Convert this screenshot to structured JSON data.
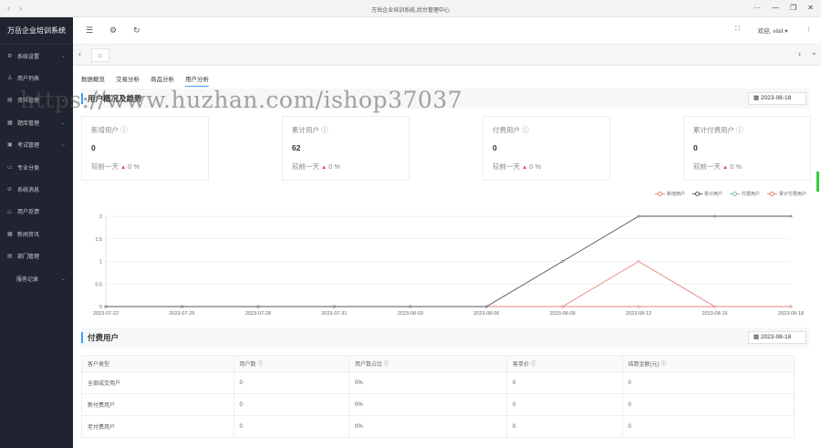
{
  "browser": {
    "url_text": "万岳企业培训系统,后台管理中心",
    "nav_back": "‹",
    "nav_forward": "›",
    "win_more": "···",
    "win_min": "—",
    "win_max": "❐",
    "win_close": "✕"
  },
  "sidebar": {
    "brand": "万岳企业培训系统",
    "items": [
      {
        "icon": "⚙",
        "label": "系统设置",
        "chevron": "⌄"
      },
      {
        "icon": "♙",
        "label": "用户列表",
        "chevron": ""
      },
      {
        "icon": "▤",
        "label": "资料管理",
        "chevron": "⌄"
      },
      {
        "icon": "▦",
        "label": "题库管理",
        "chevron": "⌄"
      },
      {
        "icon": "▣",
        "label": "考试管理",
        "chevron": "⌄"
      },
      {
        "icon": "▭",
        "label": "专业分类",
        "chevron": ""
      },
      {
        "icon": "⊘",
        "label": "系统消息",
        "chevron": ""
      },
      {
        "icon": "△",
        "label": "用户反馈",
        "chevron": ""
      },
      {
        "icon": "▦",
        "label": "新闻资讯",
        "chevron": ""
      },
      {
        "icon": "▤",
        "label": "部门管理",
        "chevron": ""
      },
      {
        "icon": "",
        "label": "服务记录",
        "chevron": "⌄"
      }
    ]
  },
  "topbar": {
    "menu_icon": "☰",
    "settings_icon": "⚙",
    "refresh_icon": "↻",
    "fullscreen_icon": "⛶",
    "user": "欢迎, visit ▾",
    "more_icon": "⋮"
  },
  "tabs": {
    "left_arrow": "‹",
    "home_icon": "⌂",
    "right_arrow": "›",
    "dropdown": "⌄"
  },
  "subtabs": [
    "数据概览",
    "交易分析",
    "商品分析",
    "用户分析"
  ],
  "active_subtab": 3,
  "section1": {
    "title": "用户概况及趋势",
    "date": "▦ 2023-08-18"
  },
  "cards": [
    {
      "label": "新增用户 ⓘ",
      "value": "0",
      "compare": "较前一天",
      "arrow": "▲",
      "pct": "0 %"
    },
    {
      "label": "累计用户 ⓘ",
      "value": "62",
      "compare": "较前一天",
      "arrow": "▲",
      "pct": "0 %"
    },
    {
      "label": "付费用户 ⓘ",
      "value": "0",
      "compare": "较前一天",
      "arrow": "▲",
      "pct": "0 %"
    },
    {
      "label": "累计付费用户 ⓘ",
      "value": "0",
      "compare": "较前一天",
      "arrow": "▲",
      "pct": "0 %"
    }
  ],
  "chart_data": {
    "type": "line",
    "categories": [
      "2023-07-22",
      "2023-07-25",
      "2023-07-28",
      "2023-07-31",
      "2023-08-03",
      "2023-08-06",
      "2023-08-09",
      "2023-08-12",
      "2023-08-15",
      "2023-08-18"
    ],
    "ylim": [
      0,
      2
    ],
    "yticks": [
      "0",
      "0.5",
      "1",
      "1.5",
      "2"
    ],
    "grid": true,
    "legend_position": "top-right",
    "series": [
      {
        "name": "新增用户",
        "color": "#e4847b",
        "values": [
          0,
          0,
          0,
          0,
          0,
          0,
          0,
          1,
          0,
          0
        ]
      },
      {
        "name": "累计用户",
        "color": "#4a5766",
        "values": [
          0,
          0,
          0,
          0,
          0,
          0,
          1,
          2,
          2,
          2
        ]
      },
      {
        "name": "付费用户",
        "color": "#8bb8c2",
        "values": [
          0,
          0,
          0,
          0,
          0,
          0,
          0,
          0,
          0,
          0
        ]
      },
      {
        "name": "累计付费用户",
        "color": "#e4847b",
        "values": [
          0,
          0,
          0,
          0,
          0,
          0,
          0,
          0,
          0,
          0
        ]
      }
    ]
  },
  "section2": {
    "title": "付费用户",
    "date": "▦ 2023-08-18"
  },
  "paid_table": {
    "headers": [
      "客户类型",
      "用户数 ⓘ",
      "用户数占比 ⓘ",
      "客单价 ⓘ",
      "结算金额(元) ⓘ"
    ],
    "rows": [
      [
        "全部成交用户",
        "0",
        "0%",
        "0",
        "0"
      ],
      [
        "新付费用户",
        "0",
        "0%",
        "0",
        "0"
      ],
      [
        "老付费用户",
        "0",
        "0%",
        "0",
        "0"
      ]
    ]
  },
  "watermark": "https://www.huzhan.com/ishop37037"
}
